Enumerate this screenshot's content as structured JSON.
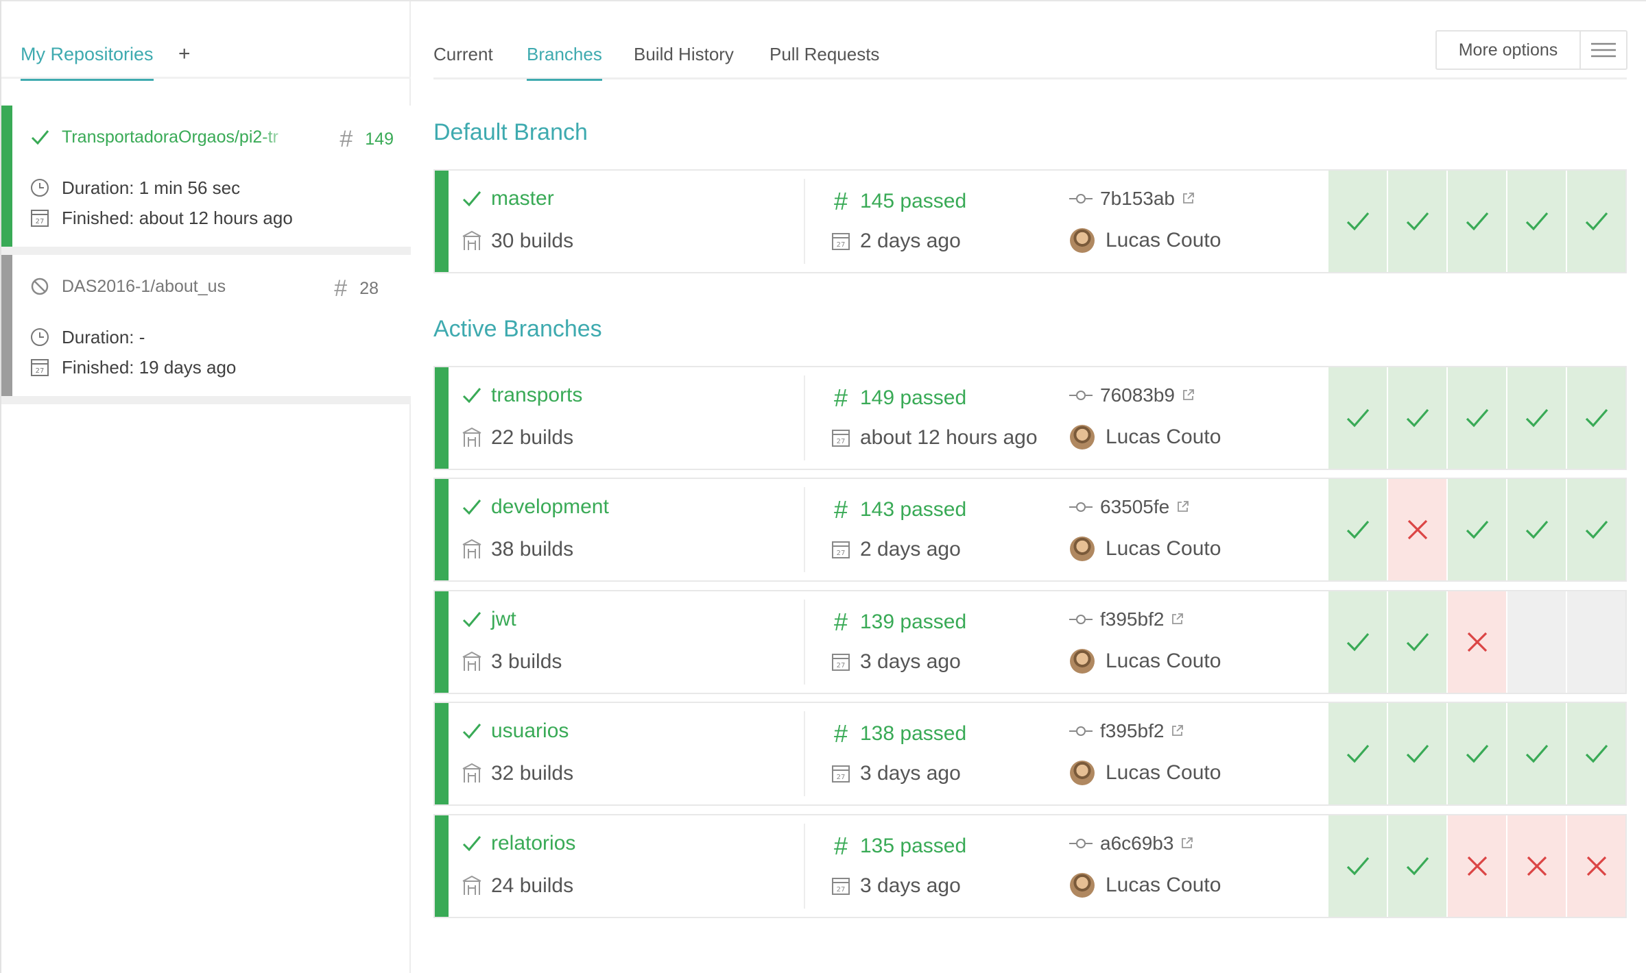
{
  "sidebar": {
    "tab_label": "My Repositories",
    "add_label": "+",
    "repos": [
      {
        "name": "TransportadoraOrgaos/pi2-tr",
        "status": "passed",
        "number": "149",
        "duration": "Duration: 1 min 56 sec",
        "finished": "Finished: about 12 hours ago"
      },
      {
        "name": "DAS2016-1/about_us",
        "status": "canceled",
        "number": "28",
        "duration": "Duration: -",
        "finished": "Finished: 19 days ago"
      }
    ]
  },
  "tabs": [
    "Current",
    "Branches",
    "Build History",
    "Pull Requests"
  ],
  "active_tab": "Branches",
  "more_options_label": "More options",
  "sections": {
    "default_title": "Default Branch",
    "active_title": "Active Branches"
  },
  "default_branch": {
    "name": "master",
    "builds": "30 builds",
    "passed": "145 passed",
    "ago": "2 days ago",
    "commit": "7b153ab",
    "author": "Lucas Couto",
    "history": [
      "passed",
      "passed",
      "passed",
      "passed",
      "passed"
    ]
  },
  "active_branches": [
    {
      "name": "transports",
      "builds": "22 builds",
      "passed": "149 passed",
      "ago": "about 12 hours ago",
      "commit": "76083b9",
      "author": "Lucas Couto",
      "history": [
        "passed",
        "passed",
        "passed",
        "passed",
        "passed"
      ]
    },
    {
      "name": "development",
      "builds": "38 builds",
      "passed": "143 passed",
      "ago": "2 days ago",
      "commit": "63505fe",
      "author": "Lucas Couto",
      "history": [
        "passed",
        "failed",
        "passed",
        "passed",
        "passed"
      ]
    },
    {
      "name": "jwt",
      "builds": "3 builds",
      "passed": "139 passed",
      "ago": "3 days ago",
      "commit": "f395bf2",
      "author": "Lucas Couto",
      "history": [
        "passed",
        "passed",
        "failed",
        "empty",
        "empty"
      ]
    },
    {
      "name": "usuarios",
      "builds": "32 builds",
      "passed": "138 passed",
      "ago": "3 days ago",
      "commit": "f395bf2",
      "author": "Lucas Couto",
      "history": [
        "passed",
        "passed",
        "passed",
        "passed",
        "passed"
      ]
    },
    {
      "name": "relatorios",
      "builds": "24 builds",
      "passed": "135 passed",
      "ago": "3 days ago",
      "commit": "a6c69b3",
      "author": "Lucas Couto",
      "history": [
        "passed",
        "passed",
        "failed",
        "failed",
        "failed"
      ]
    }
  ],
  "colors": {
    "accent": "#3eaaaf",
    "passed": "#39aa56",
    "failed": "#db4545",
    "canceled": "#9d9d9d",
    "passed_bg": "#deeedd",
    "failed_bg": "#fbe4e2",
    "empty_bg": "#efefef"
  },
  "icons": [
    "check-icon",
    "x-icon",
    "clock-icon",
    "calendar-icon",
    "cancel-icon",
    "hash-icon",
    "builds-icon",
    "commit-icon",
    "external-link-icon",
    "hamburger-icon",
    "avatar"
  ]
}
